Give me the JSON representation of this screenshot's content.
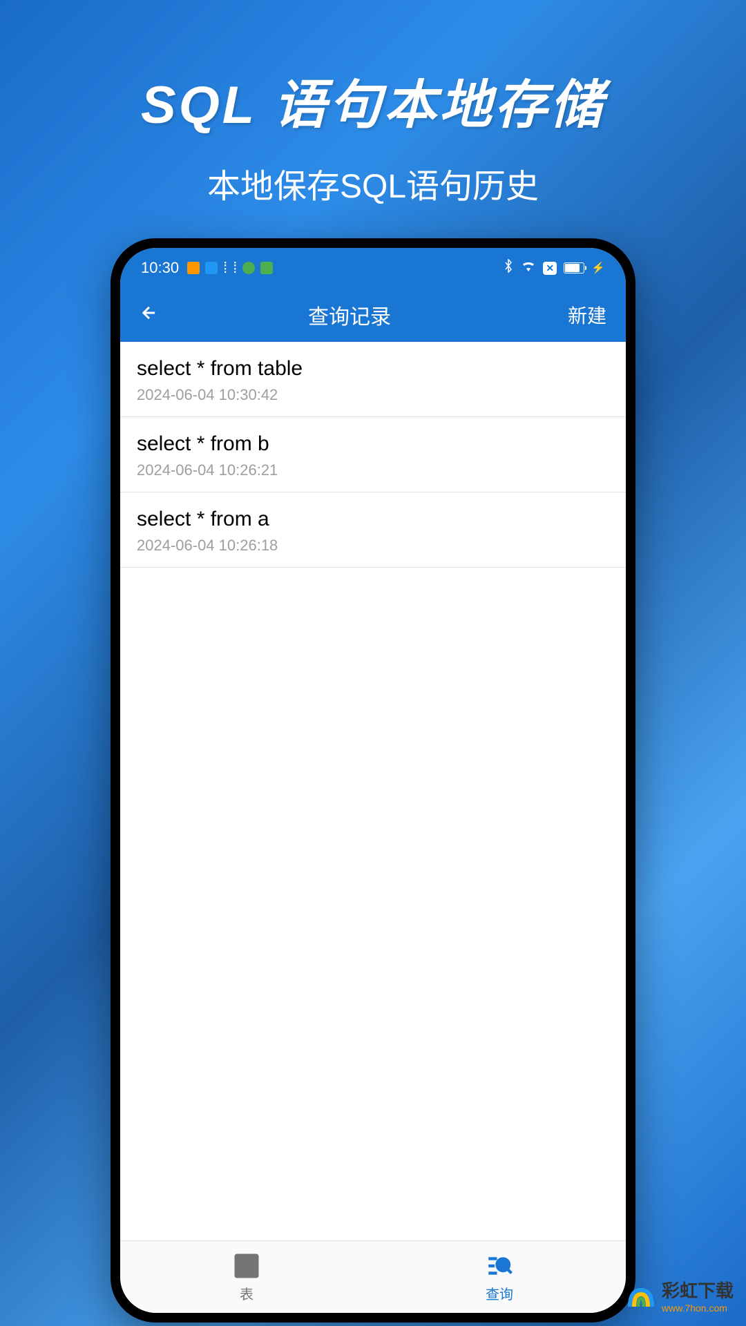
{
  "promo": {
    "title": "SQL 语句本地存储",
    "subtitle": "本地保存SQL语句历史"
  },
  "statusBar": {
    "time": "10:30"
  },
  "header": {
    "title": "查询记录",
    "newButton": "新建"
  },
  "records": [
    {
      "query": "select * from table",
      "timestamp": "2024-06-04 10:30:42"
    },
    {
      "query": "select * from b",
      "timestamp": "2024-06-04 10:26:21"
    },
    {
      "query": "select * from a",
      "timestamp": "2024-06-04 10:26:18"
    }
  ],
  "bottomNav": {
    "table": "表",
    "query": "查询"
  },
  "watermark": {
    "main": "彩虹下载",
    "sub": "www.7hon.com"
  }
}
